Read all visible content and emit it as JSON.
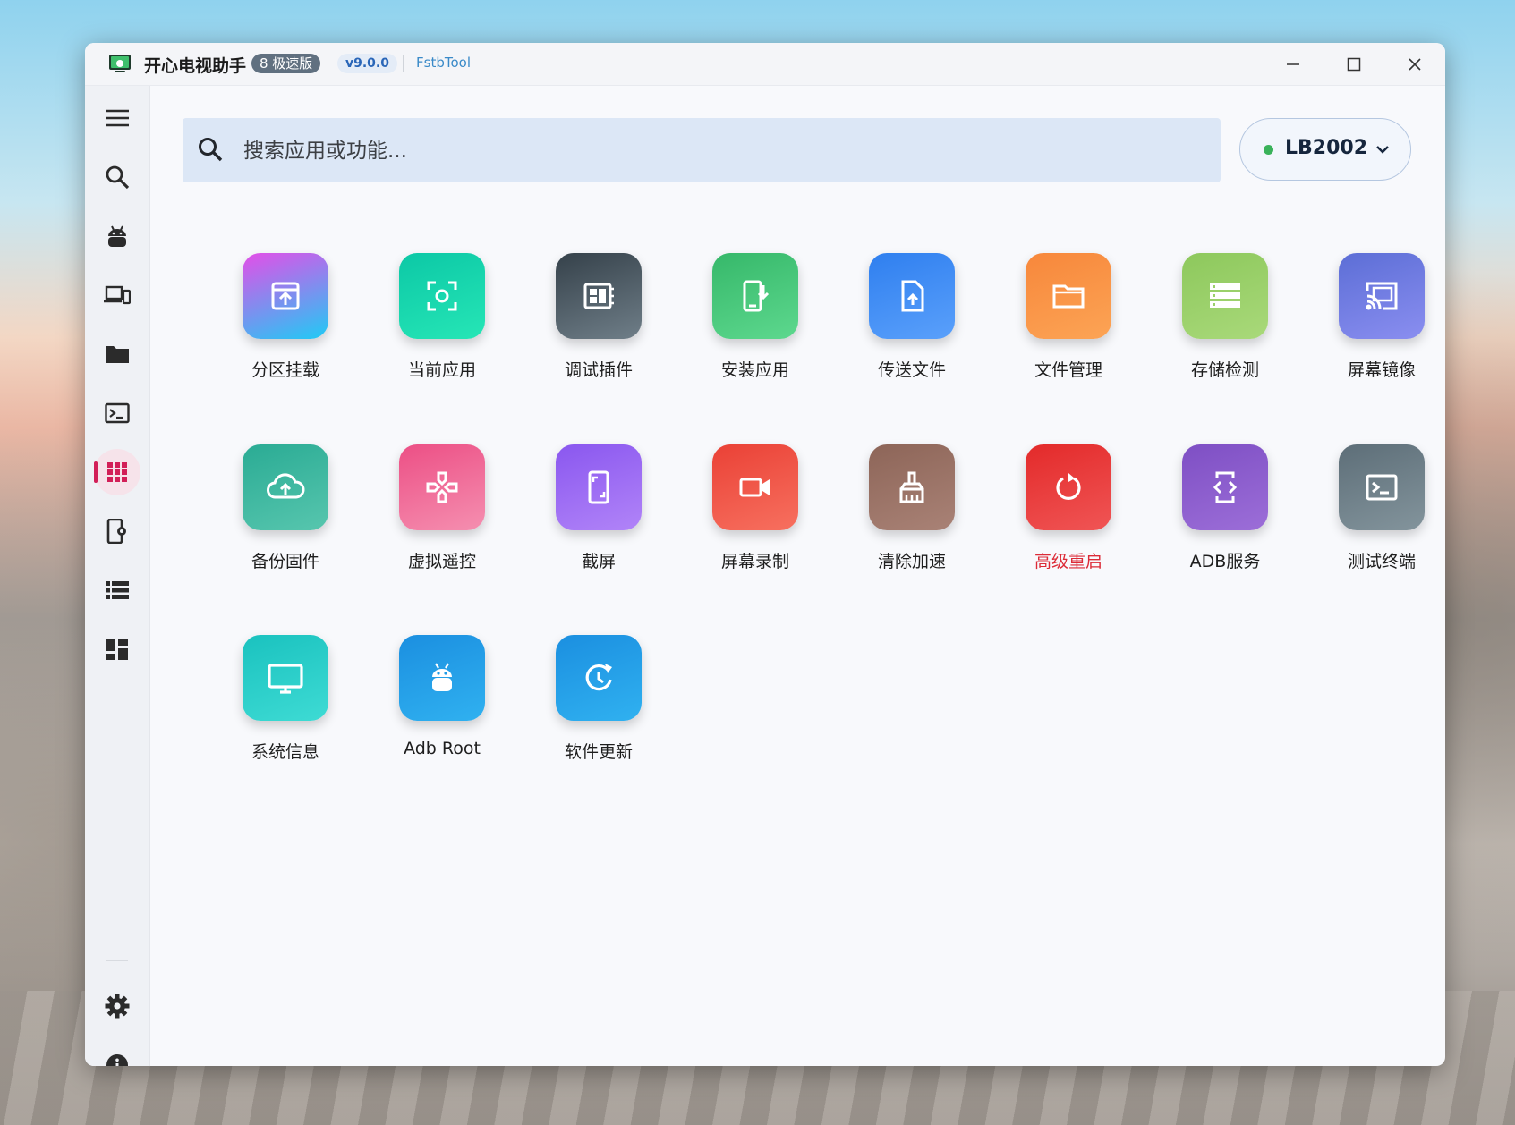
{
  "window": {
    "title": "开心电视助手",
    "speed_badge": "8 极速版",
    "version": "v9.0.0",
    "tool_link": "FstbTool"
  },
  "search": {
    "placeholder": "搜索应用或功能..."
  },
  "device": {
    "name": "LB2002",
    "status_color": "#3ab25a"
  },
  "sidebar": {
    "items": [
      {
        "icon": "menu-icon"
      },
      {
        "icon": "search-icon"
      },
      {
        "icon": "android-icon"
      },
      {
        "icon": "devices-icon"
      },
      {
        "icon": "folder-icon"
      },
      {
        "icon": "terminal-icon"
      },
      {
        "icon": "apps-grid-icon",
        "active": true
      },
      {
        "icon": "app-settings-icon"
      },
      {
        "icon": "list-icon"
      },
      {
        "icon": "dashboard-icon"
      },
      {
        "icon": "gear-icon"
      },
      {
        "icon": "info-icon"
      }
    ]
  },
  "tiles": [
    {
      "label": "分区挂载",
      "icon": "partition-mount-icon"
    },
    {
      "label": "当前应用",
      "icon": "current-app-icon"
    },
    {
      "label": "调试插件",
      "icon": "debug-plugin-icon"
    },
    {
      "label": "安装应用",
      "icon": "install-app-icon"
    },
    {
      "label": "传送文件",
      "icon": "send-file-icon"
    },
    {
      "label": "文件管理",
      "icon": "file-manager-icon"
    },
    {
      "label": "存储检测",
      "icon": "storage-check-icon"
    },
    {
      "label": "屏幕镜像",
      "icon": "screen-cast-icon"
    },
    {
      "label": "备份固件",
      "icon": "backup-cloud-icon"
    },
    {
      "label": "虚拟遥控",
      "icon": "remote-control-icon"
    },
    {
      "label": "截屏",
      "icon": "screenshot-icon"
    },
    {
      "label": "屏幕录制",
      "icon": "screen-record-icon"
    },
    {
      "label": "清除加速",
      "icon": "cleaner-broom-icon"
    },
    {
      "label": "高级重启",
      "icon": "reboot-icon"
    },
    {
      "label": "ADB服务",
      "icon": "adb-service-icon"
    },
    {
      "label": "测试终端",
      "icon": "terminal-test-icon"
    },
    {
      "label": "系统信息",
      "icon": "system-info-icon"
    },
    {
      "label": "Adb Root",
      "icon": "adb-root-icon"
    },
    {
      "label": "软件更新",
      "icon": "software-update-icon"
    }
  ],
  "colors": {
    "accent": "#d21f58",
    "warning_label": "#dc2b37"
  }
}
